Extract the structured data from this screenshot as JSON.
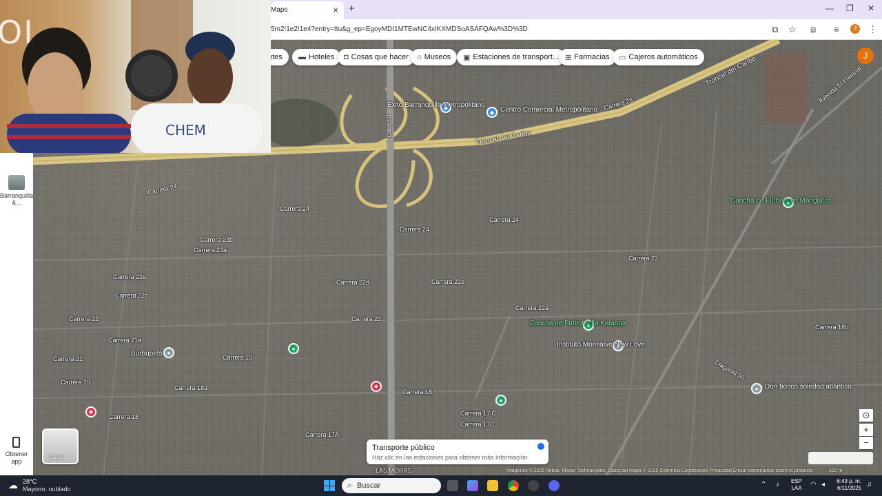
{
  "browser": {
    "tab_title": "Maps",
    "url": "5m2!1e2!1e4?entry=ttu&g_ep=EgoyMDI1MTEwNC4xIKXMDSoASAFQAw%3D%3D",
    "profile_initial": "J"
  },
  "chips": [
    {
      "label": "ntes",
      "icon": "restaurant-icon"
    },
    {
      "label": "Hoteles",
      "icon": "bed-icon"
    },
    {
      "label": "Cosas que hacer",
      "icon": "camera-icon"
    },
    {
      "label": "Museos",
      "icon": "museum-icon"
    },
    {
      "label": "Estaciones de transport...",
      "icon": "transit-icon"
    },
    {
      "label": "Farmacias",
      "icon": "pharmacy-icon"
    },
    {
      "label": "Cajeros automáticos",
      "icon": "atm-icon"
    }
  ],
  "user_avatar": "J",
  "webcam": {
    "letters": "OL"
  },
  "left_rail": {
    "place_label": "Barranquilla &...",
    "get_app_label": "Obtener app"
  },
  "layers_label": "Capas",
  "map": {
    "roads": [
      {
        "label": "Troncal del Caribe"
      },
      {
        "label": "Troncal del Caribe"
      },
      {
        "label": "Avenida El Platanal"
      },
      {
        "label": "Calle 63"
      },
      {
        "label": "Carrera 24"
      },
      {
        "label": "Carrera 24"
      },
      {
        "label": "Carrera 24"
      },
      {
        "label": "Carrera 24"
      },
      {
        "label": "Carrera 23b"
      },
      {
        "label": "Carrera 23a"
      },
      {
        "label": "Carrera 22e"
      },
      {
        "label": "Carrera 22c"
      },
      {
        "label": "Carrera 22d"
      },
      {
        "label": "Carrera 22"
      },
      {
        "label": "Carrera 22"
      },
      {
        "label": "Carrera 21a"
      },
      {
        "label": "Carrera 21"
      },
      {
        "label": "Carrera 19"
      },
      {
        "label": "Carrera 19"
      },
      {
        "label": "Carrera 18a"
      },
      {
        "label": "Carrera 18"
      },
      {
        "label": "Carrera 18"
      },
      {
        "label": "Carrera 17 C"
      },
      {
        "label": "Carrera 17C"
      },
      {
        "label": "Carrera 17A"
      },
      {
        "label": "Carrera 23"
      },
      {
        "label": "Carrera 22e"
      },
      {
        "label": "Carrera 22a"
      },
      {
        "label": "Carrera 28"
      },
      {
        "label": "Diagonal 50"
      },
      {
        "label": "Carrera 18b"
      }
    ],
    "pois": [
      {
        "label": "Éxito Barranquilla Metropolitano",
        "kind": "blue"
      },
      {
        "label": "Centro Comercial Metropolitano",
        "kind": "blue"
      },
      {
        "label": "Cancha de Futbol Los Manguitos",
        "kind": "green"
      },
      {
        "label": "Cancha de Futbol Villa Katanga",
        "kind": "green"
      },
      {
        "label": "Instituto Monsalve New Love",
        "kind": "grey"
      },
      {
        "label": "Burbupets",
        "kind": "grey"
      },
      {
        "label": "Don bosco soledad atlántico",
        "kind": "grey"
      },
      {
        "label": "LAS MORAS",
        "kind": "grey"
      }
    ]
  },
  "transport_toast": {
    "title": "Transporte público",
    "description": "Haz clic en las estaciones para obtener más información."
  },
  "attribution": "Imágenes © 2025 Airbus, Maxar Technologies, Datos del mapa © 2025   Colombia   Condiciones   Privacidad   Enviar comentarios sobre el producto",
  "scale": "100 m",
  "taskbar": {
    "weather_temp": "28°C",
    "weather_desc": "Mayorm. nublado",
    "search_placeholder": "Buscar",
    "lang_line1": "ESP",
    "lang_line2": "LAA",
    "time": "6:43 p. m.",
    "date": "6/11/2025"
  },
  "colors": {
    "map_base": "#6f6c66",
    "highway": "#e8d48a",
    "accent_blue": "#1a73e8",
    "poi_green": "#1fa463",
    "taskbar": "#1f2530"
  }
}
